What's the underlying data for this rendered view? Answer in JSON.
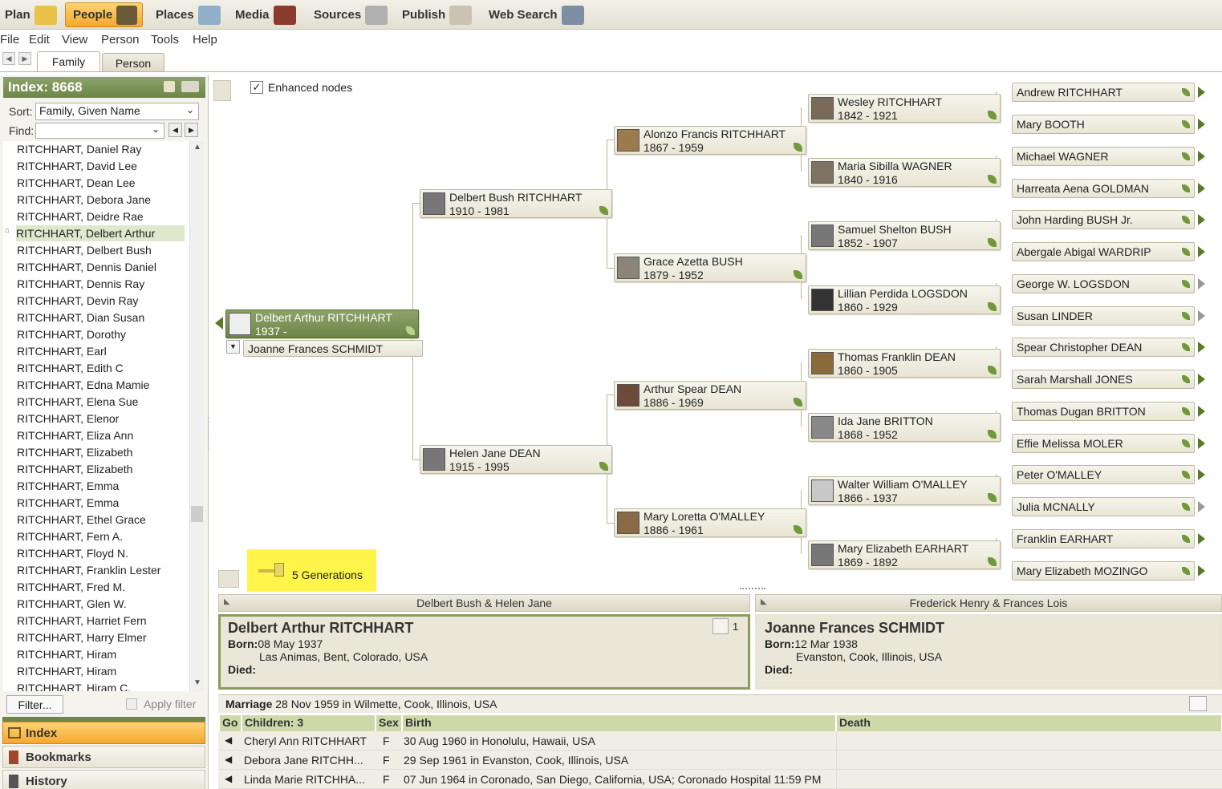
{
  "modules": [
    {
      "label": "Plan",
      "icon": "plan-icon"
    },
    {
      "label": "People",
      "icon": "people-icon"
    },
    {
      "label": "Places",
      "icon": "places-icon"
    },
    {
      "label": "Media",
      "icon": "media-icon"
    },
    {
      "label": "Sources",
      "icon": "sources-icon"
    },
    {
      "label": "Publish",
      "icon": "publish-icon"
    },
    {
      "label": "Web Search",
      "icon": "web-search-icon"
    }
  ],
  "menu": [
    "File",
    "Edit",
    "View",
    "Person",
    "Tools",
    "Help"
  ],
  "tabs": [
    "Family",
    "Person"
  ],
  "sidebar": {
    "index_title": "Index: 8668",
    "sort_label": "Sort:",
    "sort_value": "Family, Given Name",
    "find_label": "Find:",
    "filter_button": "Filter...",
    "apply_filter": "Apply filter",
    "names": [
      "RITCHHART, Daniel Ray",
      "RITCHHART, David Lee",
      "RITCHHART, Dean Lee",
      "RITCHHART, Debora Jane",
      "RITCHHART, Deidre Rae",
      "RITCHHART, Delbert Arthur",
      "RITCHHART, Delbert Bush",
      "RITCHHART, Dennis Daniel",
      "RITCHHART, Dennis Ray",
      "RITCHHART, Devin Ray",
      "RITCHHART, Dian Susan",
      "RITCHHART, Dorothy",
      "RITCHHART, Earl",
      "RITCHHART, Edith C",
      "RITCHHART, Edna Mamie",
      "RITCHHART, Elena Sue",
      "RITCHHART, Elenor",
      "RITCHHART, Eliza Ann",
      "RITCHHART, Elizabeth",
      "RITCHHART, Elizabeth",
      "RITCHHART, Emma",
      "RITCHHART, Emma",
      "RITCHHART, Ethel Grace",
      "RITCHHART, Fern A.",
      "RITCHHART, Floyd N.",
      "RITCHHART, Franklin Lester",
      "RITCHHART, Fred M.",
      "RITCHHART, Glen W.",
      "RITCHHART, Harriet Fern",
      "RITCHHART, Harry Elmer",
      "RITCHHART, Hiram",
      "RITCHHART, Hiram",
      "RITCHHART, Hiram C."
    ],
    "sections": [
      "Index",
      "Bookmarks",
      "History"
    ]
  },
  "chart": {
    "enhanced_nodes": "Enhanced nodes",
    "generations": "5 Generations",
    "root": {
      "name": "Delbert Arthur RITCHHART",
      "dates": "1937 -"
    },
    "spouse": "Joanne Frances SCHMIDT",
    "gen2": [
      {
        "name": "Delbert Bush RITCHHART",
        "dates": "1910 - 1981"
      },
      {
        "name": "Helen Jane DEAN",
        "dates": "1915 - 1995"
      }
    ],
    "gen3": [
      {
        "name": "Alonzo Francis RITCHHART",
        "dates": "1867 - 1959"
      },
      {
        "name": "Grace Azetta BUSH",
        "dates": "1879 - 1952"
      },
      {
        "name": "Arthur Spear DEAN",
        "dates": "1886 - 1969"
      },
      {
        "name": "Mary Loretta O'MALLEY",
        "dates": "1886 - 1961"
      }
    ],
    "gen4": [
      {
        "name": "Wesley RITCHHART",
        "dates": "1842 - 1921"
      },
      {
        "name": "Maria Sibilla WAGNER",
        "dates": "1840 - 1916"
      },
      {
        "name": "Samuel Shelton BUSH",
        "dates": "1852 - 1907"
      },
      {
        "name": "Lillian Perdida LOGSDON",
        "dates": "1860 - 1929"
      },
      {
        "name": "Thomas Franklin DEAN",
        "dates": "1860 - 1905"
      },
      {
        "name": "Ida Jane BRITTON",
        "dates": "1868 - 1952"
      },
      {
        "name": "Walter William O'MALLEY",
        "dates": "1866 - 1937"
      },
      {
        "name": "Mary Elizabeth EARHART",
        "dates": "1869 - 1892"
      }
    ],
    "gen5": [
      "Andrew RITCHHART",
      "Mary BOOTH",
      "Michael WAGNER",
      "Harreata Aena GOLDMAN",
      "John Harding BUSH Jr.",
      "Abergale Abigal WARDRIP",
      "George W. LOGSDON",
      "Susan LINDER",
      "Spear Christopher DEAN",
      "Sarah Marshall JONES",
      "Thomas Dugan BRITTON",
      "Effie Melissa MOLER",
      "Peter O'MALLEY",
      "Julia MCNALLY",
      "Franklin EARHART",
      "Mary Elizabeth MOZINGO"
    ]
  },
  "family": {
    "parents_left": "Delbert Bush & Helen Jane",
    "parents_right": "Frederick Henry & Frances Lois",
    "husband": {
      "name": "Delbert Arthur RITCHHART",
      "born_label": "Born:",
      "born": "08 May 1937",
      "place": "Las Animas, Bent, Colorado, USA",
      "died_label": "Died:",
      "count": "1"
    },
    "wife": {
      "name": "Joanne Frances SCHMIDT",
      "born_label": "Born:",
      "born": "12 Mar 1938",
      "place": "Evanston, Cook, Illinois, USA",
      "died_label": "Died:"
    },
    "marriage_label": "Marriage",
    "marriage": "28 Nov 1959 in Wilmette, Cook, Illinois, USA",
    "headers": [
      "Go",
      "Children: 3",
      "Sex",
      "Birth",
      "Death"
    ],
    "children": [
      {
        "name": "Cheryl Ann RITCHHART",
        "sex": "F",
        "birth": "30 Aug 1960 in Honolulu, Hawaii, USA",
        "death": ""
      },
      {
        "name": "Debora Jane RITCHH...",
        "sex": "F",
        "birth": "29 Sep 1961 in Evanston, Cook, Illinois, USA",
        "death": ""
      },
      {
        "name": "Linda Marie RITCHHA...",
        "sex": "F",
        "birth": "07 Jun 1964 in Coronado, San Diego, California, USA; Coronado Hospital 11:59 PM",
        "death": ""
      }
    ]
  }
}
